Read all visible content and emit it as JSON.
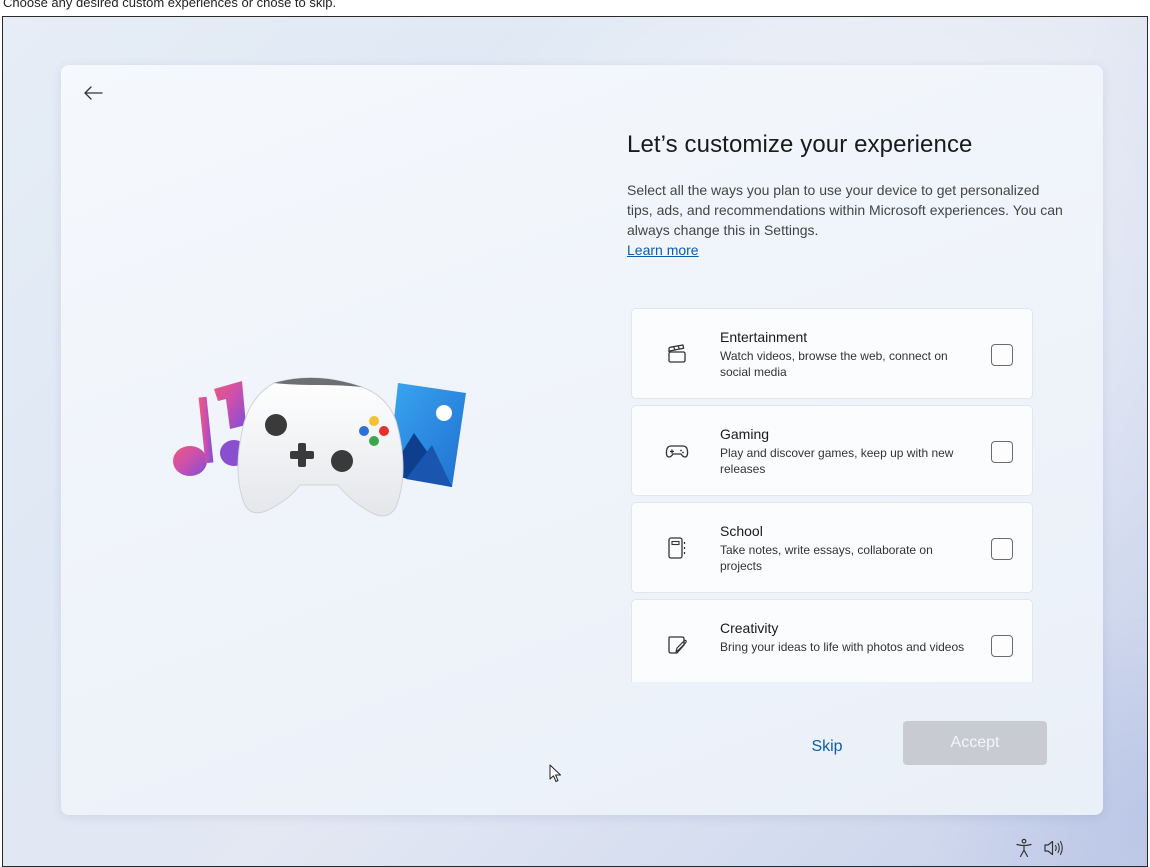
{
  "caption": "Choose any desired custom experiences or chose to skip.",
  "page": {
    "title": "Let’s customize your experience",
    "description": "Select all the ways you plan to use your device to get personalized tips, ads, and recommendations within Microsoft experiences. You can always change this in Settings.",
    "learn_more": "Learn more"
  },
  "options": [
    {
      "title": "Entertainment",
      "description": "Watch videos, browse the web, connect on social media",
      "icon": "clapperboard-icon",
      "checked": false
    },
    {
      "title": "Gaming",
      "description": "Play and discover games, keep up with new releases",
      "icon": "gamepad-icon",
      "checked": false
    },
    {
      "title": "School",
      "description": "Take notes, write essays, collaborate on projects",
      "icon": "notebook-icon",
      "checked": false
    },
    {
      "title": "Creativity",
      "description": "Bring your ideas to life with photos and videos",
      "icon": "sticky-note-pen-icon",
      "checked": false
    }
  ],
  "buttons": {
    "skip": "Skip",
    "accept": "Accept"
  },
  "colors": {
    "accent_link": "#0b5cab",
    "accept_disabled_bg": "#c8ccd2"
  },
  "system_tray": {
    "icons": [
      "accessibility-icon",
      "volume-icon"
    ]
  }
}
